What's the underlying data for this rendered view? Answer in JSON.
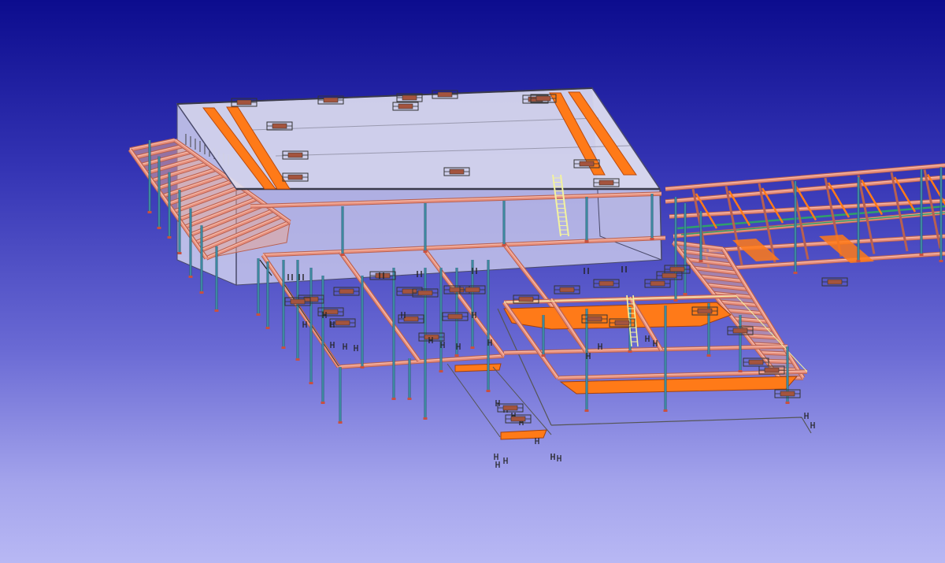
{
  "viewport": {
    "background_top": "#0c0c8e",
    "background_bottom": "#b8b8f4"
  },
  "model": {
    "type": "3d-structural-steel-model",
    "render_mode": "transparent-shaded",
    "colors": {
      "wall": "#cfd0ee",
      "wall_edge": "#4a4a6a",
      "beam": "#e8907e",
      "beam_edge": "#b86050",
      "plate": "#ff7a18",
      "column": "#3e8ea6",
      "bracing": "#2fa06a",
      "detail": "#222222",
      "highlight": "#f2f2a0"
    },
    "components": [
      "main-building-envelope",
      "roof-slab",
      "roof-edge-plates",
      "left-stair-canopy",
      "front-floor-frame",
      "right-pipe-rack",
      "right-stair-ramp",
      "lower-platform",
      "loading-dock",
      "columns",
      "ladder",
      "connection-plates"
    ]
  }
}
